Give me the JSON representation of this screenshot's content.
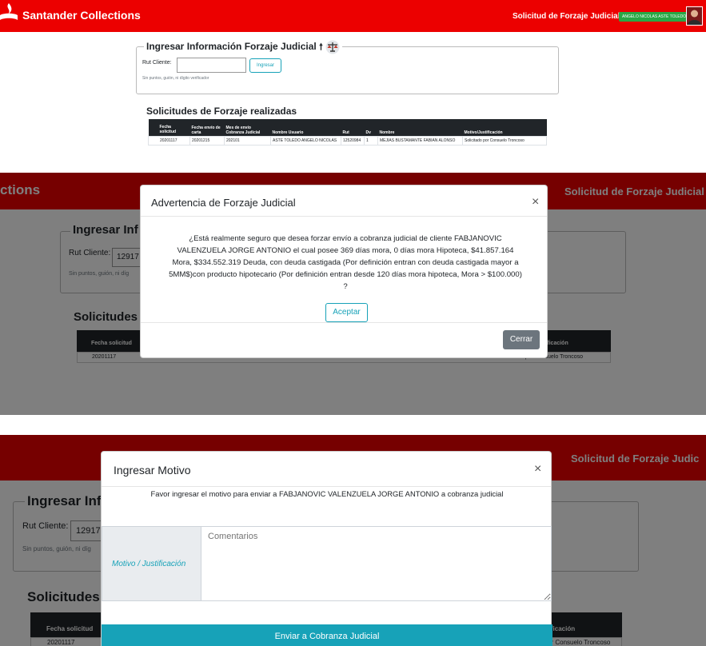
{
  "header": {
    "brand": "Santander Collections",
    "brand_cut": "ctions",
    "page_title": "Solicitud de Forzaje Judicial",
    "page_title_cut": "Solicitud de Forzaje Judic",
    "user": "ANGELO NICOLAS ASTE TOLEDO"
  },
  "form": {
    "legend": "Ingresar Información Forzaje Judicial",
    "legend_cut": "Ingresar Inf",
    "rut_label": "Rut Cliente:",
    "rut_value": "",
    "rut_value_shot2": "12917",
    "submit_label": "Ingresar",
    "hint": "Sin puntos, guión, ni dígito verificador",
    "hint_cut": "Sin puntos, guión, ni díg"
  },
  "requests": {
    "title": "Solicitudes de Forzaje realizadas",
    "title_cut": "Solicitudes",
    "columns": [
      "Fecha solicitud",
      "Fecha envío de carta",
      "Mes de envío Cobranza Judicial",
      "Nombre Usuario",
      "Rut",
      "Dv",
      "Nombre",
      "Motivo/Justificación"
    ],
    "col_fecha": "Fecha solicitud",
    "col_motivo_cut": "tificación",
    "rows": [
      {
        "fecha": "20201117",
        "carta": "20201215",
        "mes": "202101",
        "usuario": "ASTE TOLEDO ANGELO NICOLAS",
        "rut": "12520984",
        "dv": "1",
        "nombre": "MEJIAS BUSTAMANTE FABIAN ALONSO",
        "motivo": "Solicitado por Consuelo Troncoso"
      }
    ],
    "motivo_cut2": "ado por Consuelo Troncoso",
    "motivo_cut3": "or Consuelo Troncoso"
  },
  "warning_modal": {
    "title": "Advertencia de Forzaje Judicial",
    "close_icon": "×",
    "message": "¿Está realmente seguro que desea forzar envío a cobranza judicial de cliente FABJANOVIC VALENZUELA JORGE ANTONIO el cual posee 369 días mora, 0 días mora Hipoteca, $41.857.164 Mora, $334.552.319 Deuda, con deuda castigada (Por definición entran con deuda castigada mayor a 5MM$)con producto hipotecario (Por definición entran desde 120 días mora hipoteca, Mora > $100.000) ?",
    "accept_label": "Aceptar",
    "close_label": "Cerrar"
  },
  "motivo_modal": {
    "title": "Ingresar Motivo",
    "close_icon": "×",
    "message": "Favor ingresar el motivo para enviar a FABJANOVIC VALENZUELA JORGE ANTONIO a cobranza judicial",
    "field_label": "Motivo / Justificación",
    "placeholder": "Comentarios",
    "submit_label": "Enviar a Cobranza Judicial"
  },
  "colors": {
    "brand_red": "#ec0000",
    "teal": "#17a2b8",
    "success": "#28a745",
    "gray_button": "#6c757d"
  }
}
